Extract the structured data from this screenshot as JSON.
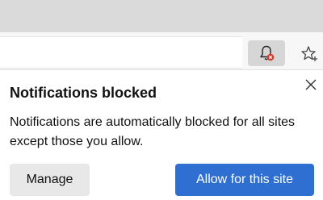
{
  "toolbar": {
    "notification_icon": "bell-blocked-icon",
    "favorite_icon": "star-add-icon",
    "notification_badge_color": "#d83b2b"
  },
  "popup": {
    "title": "Notifications blocked",
    "message": "Notifications are automatically blocked for all sites except those you allow.",
    "manage_label": "Manage",
    "allow_label": "Allow for this site",
    "close_icon": "close-icon",
    "accent_color": "#2f6fd1"
  }
}
